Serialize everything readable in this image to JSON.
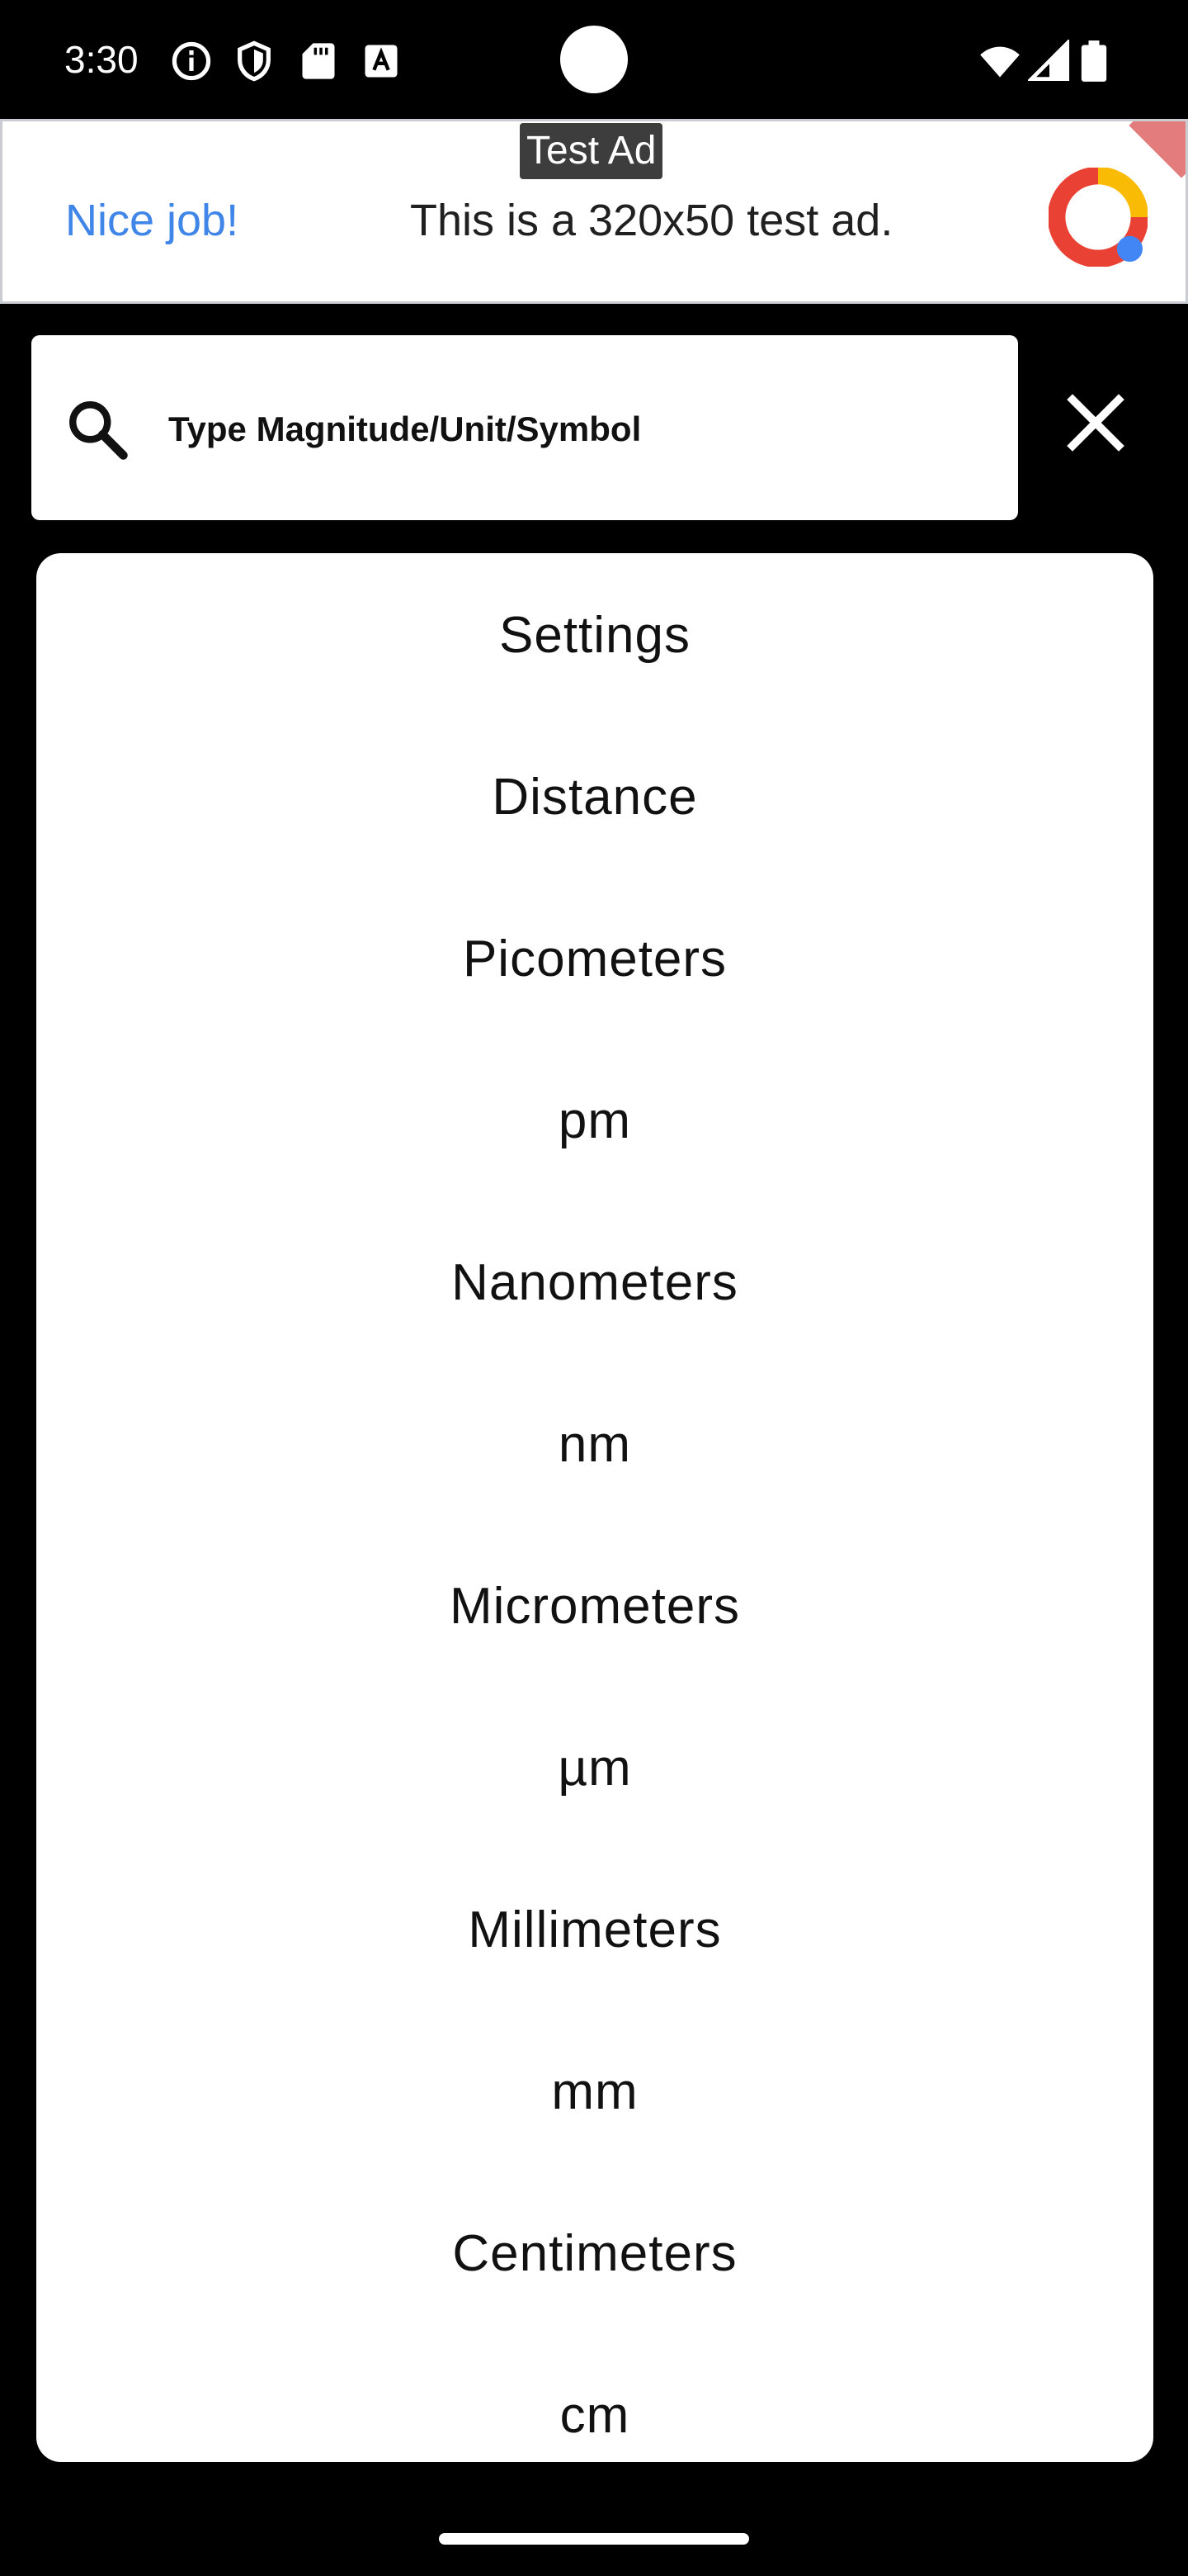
{
  "status_bar": {
    "time": "3:30",
    "icons": [
      "info-icon",
      "shield-icon",
      "sd-card-icon",
      "font-a-icon",
      "wifi-icon",
      "signal-icon",
      "battery-icon"
    ]
  },
  "ad": {
    "badge": "Test Ad",
    "headline": "Nice job!",
    "body": "This is a 320x50 test ad.",
    "headline_color": "#3f86e8"
  },
  "search": {
    "placeholder": "Type Magnitude/Unit/Symbol",
    "search_icon": "search-icon",
    "close_icon": "close-icon"
  },
  "results": {
    "items": [
      "Settings",
      "Distance",
      "Picometers",
      "pm",
      "Nanometers",
      "nm",
      "Micrometers",
      "µm",
      "Millimeters",
      "mm",
      "Centimeters",
      "cm"
    ]
  }
}
